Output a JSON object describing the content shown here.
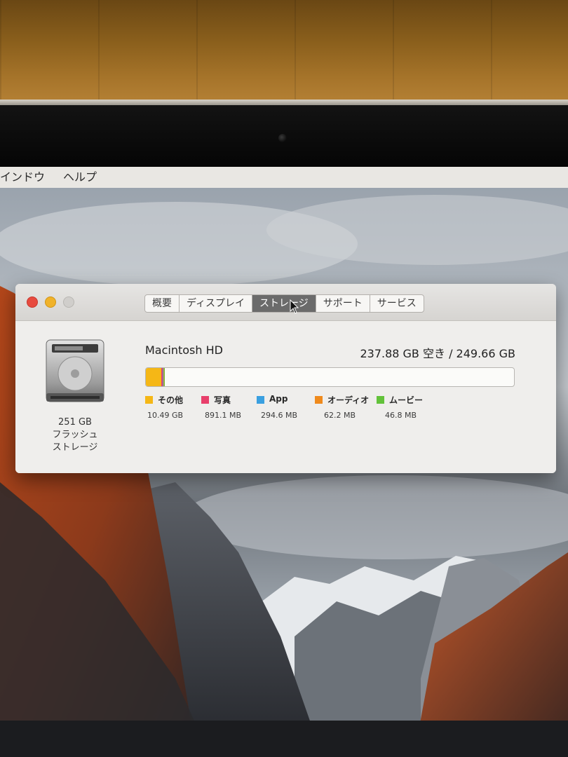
{
  "menubar": {
    "items": [
      "インドウ",
      "ヘルプ"
    ]
  },
  "window": {
    "tabs": [
      {
        "label": "概要",
        "active": false
      },
      {
        "label": "ディスプレイ",
        "active": false
      },
      {
        "label": "ストレージ",
        "active": true
      },
      {
        "label": "サポート",
        "active": false
      },
      {
        "label": "サービス",
        "active": false
      }
    ],
    "disk": {
      "capacity_lines": [
        "251 GB",
        "フラッシュ",
        "ストレージ"
      ],
      "name": "Macintosh HD",
      "free_text": "237.88 GB 空き / 249.66 GB",
      "total_gb": 249.66
    },
    "categories": [
      {
        "label": "その他",
        "size": "10.49 GB",
        "color": "#f5b716",
        "gb": 10.49
      },
      {
        "label": "写真",
        "size": "891.1 MB",
        "color": "#e83f6b",
        "gb": 0.8911
      },
      {
        "label": "App",
        "size": "294.6 MB",
        "color": "#3aa0e0",
        "gb": 0.2946
      },
      {
        "label": "オーディオ",
        "size": "62.2 MB",
        "color": "#ef8a1c",
        "gb": 0.0622
      },
      {
        "label": "ムービー",
        "size": "46.8 MB",
        "color": "#62c23a",
        "gb": 0.0468
      }
    ]
  }
}
